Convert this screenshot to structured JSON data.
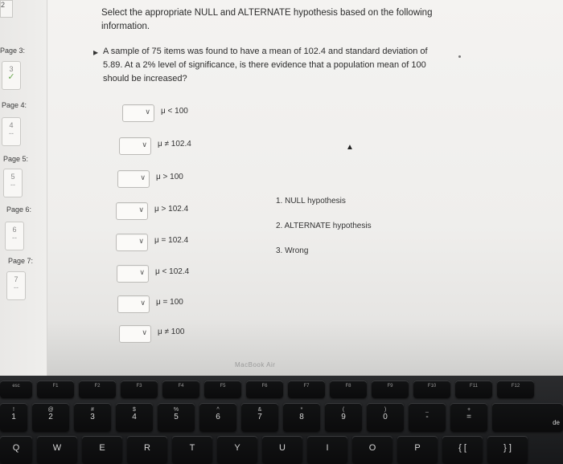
{
  "sidebar": {
    "top_number": "2",
    "pages": [
      {
        "label": "Page 3:",
        "number": "3",
        "mark": "✓"
      },
      {
        "label": "Page 4:",
        "number": "4",
        "mark": "--"
      },
      {
        "label": "Page 5:",
        "number": "5",
        "mark": "--"
      },
      {
        "label": "Page 6:",
        "number": "6",
        "mark": "--"
      },
      {
        "label": "Page 7:",
        "number": "7",
        "mark": "--"
      }
    ]
  },
  "instructions": "Select the appropriate NULL and ALTERNATE hypothesis based on the following information.",
  "question": "A sample of 75 items was found to have a mean of 102.4 and standard deviation of 5.89. At a 2% level of significance, is there evidence that a population mean of 100 should be increased?",
  "choices": [
    {
      "dropdown_value": "",
      "text": "μ < 100"
    },
    {
      "dropdown_value": "",
      "text": "μ ≠ 102.4"
    },
    {
      "dropdown_value": "",
      "text": "μ > 100"
    },
    {
      "dropdown_value": "",
      "text": "μ > 102.4"
    },
    {
      "dropdown_value": "",
      "text": "μ = 102.4"
    },
    {
      "dropdown_value": "",
      "text": "μ < 102.4"
    },
    {
      "dropdown_value": "",
      "text": "μ = 100"
    },
    {
      "dropdown_value": "",
      "text": "μ ≠ 100"
    }
  ],
  "answer_key": [
    "1.  NULL hypothesis",
    "2.  ALTERNATE hypothesis",
    "3.  Wrong"
  ],
  "laptop_label": "MacBook Air",
  "keyboard": {
    "function_row": [
      "esc",
      "F1",
      "F2",
      "F3",
      "F4",
      "F5",
      "F6",
      "F7",
      "F8",
      "F9",
      "F10",
      "F11",
      "F12"
    ],
    "number_row": [
      {
        "sym": "!",
        "n": "1"
      },
      {
        "sym": "@",
        "n": "2"
      },
      {
        "sym": "#",
        "n": "3"
      },
      {
        "sym": "$",
        "n": "4"
      },
      {
        "sym": "%",
        "n": "5"
      },
      {
        "sym": "^",
        "n": "6"
      },
      {
        "sym": "&",
        "n": "7"
      },
      {
        "sym": "*",
        "n": "8"
      },
      {
        "sym": "(",
        "n": "9"
      },
      {
        "sym": ")",
        "n": "0"
      },
      {
        "sym": "_",
        "n": "-"
      },
      {
        "sym": "+",
        "n": "="
      }
    ],
    "letter_row": [
      "Q",
      "W",
      "E",
      "R",
      "T",
      "Y",
      "U",
      "I",
      "O",
      "P",
      "{ [",
      "} ]"
    ],
    "edge_label": "de"
  }
}
